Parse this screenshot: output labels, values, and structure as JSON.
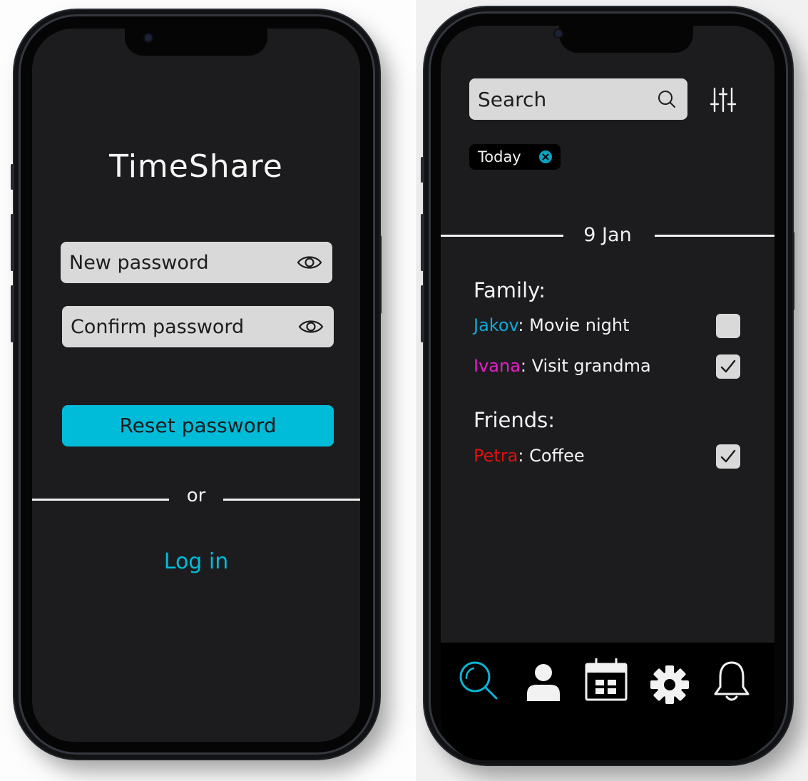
{
  "reset_screen": {
    "app_title": "TimeShare",
    "new_password_placeholder": "New password",
    "confirm_password_placeholder": "Confirm password",
    "reset_button_label": "Reset password",
    "divider_text": "or",
    "login_link_label": "Log in",
    "icons": [
      "eye-icon",
      "eye-icon"
    ],
    "accent_color": "#00bcd9"
  },
  "calendar_screen": {
    "search_placeholder": "Search",
    "filter_chip_label": "Today",
    "date_header": "9 Jan",
    "groups": [
      {
        "title": "Family:",
        "items": [
          {
            "person": "Jakov",
            "task": ": Movie night",
            "checked": false,
            "person_color": "#10a9d6"
          },
          {
            "person": "Ivana",
            "task": ": Visit grandma",
            "checked": true,
            "person_color": "#e81cc6"
          }
        ]
      },
      {
        "title": "Friends:",
        "items": [
          {
            "person": "Petra",
            "task": ": Coffee",
            "checked": true,
            "person_color": "#e00f0f"
          }
        ]
      }
    ],
    "bottom_nav": [
      "search-icon",
      "user-icon",
      "calendar-icon",
      "gear-icon",
      "bell-icon"
    ],
    "active_nav": "search-icon"
  }
}
